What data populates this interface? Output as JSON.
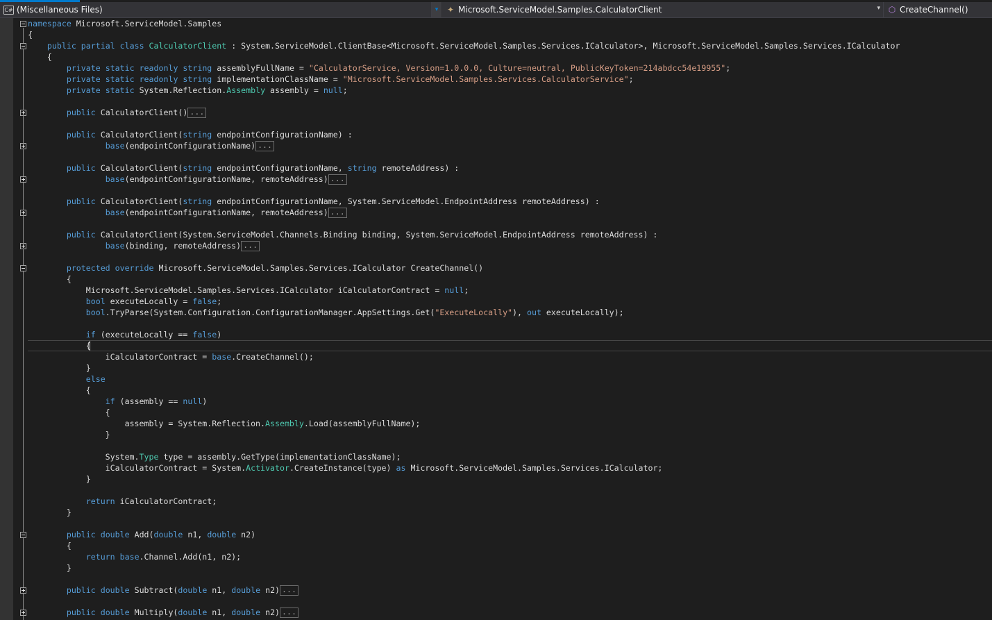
{
  "navbar": {
    "project": "(Miscellaneous Files)",
    "type": "Microsoft.ServiceModel.Samples.CalculatorClient",
    "member": "CreateChannel()"
  },
  "icons": {
    "project": "csharp-file-icon",
    "type": "class-icon",
    "member": "method-icon"
  },
  "colors": {
    "keyword": "#569cd6",
    "type": "#4ec9b0",
    "string": "#d69d85",
    "plain": "#dcdcdc",
    "background": "#1e1e1e"
  },
  "collapsed_marker": "...",
  "code": [
    [
      [
        "kw",
        "namespace"
      ],
      [
        "pl",
        " Microsoft.ServiceModel.Samples"
      ]
    ],
    [
      [
        "pl",
        "{"
      ]
    ],
    [
      [
        "pl",
        "    "
      ],
      [
        "kw",
        "public"
      ],
      [
        "pl",
        " "
      ],
      [
        "kw",
        "partial"
      ],
      [
        "pl",
        " "
      ],
      [
        "kw",
        "class"
      ],
      [
        "pl",
        " "
      ],
      [
        "ty",
        "CalculatorClient"
      ],
      [
        "pl",
        " : System.ServiceModel.ClientBase<Microsoft.ServiceModel.Samples.Services.ICalculator>, Microsoft.ServiceModel.Samples.Services.ICalculator"
      ]
    ],
    [
      [
        "pl",
        "    {"
      ]
    ],
    [
      [
        "pl",
        "        "
      ],
      [
        "kw",
        "private"
      ],
      [
        "pl",
        " "
      ],
      [
        "kw",
        "static"
      ],
      [
        "pl",
        " "
      ],
      [
        "kw",
        "readonly"
      ],
      [
        "pl",
        " "
      ],
      [
        "kw",
        "string"
      ],
      [
        "pl",
        " assemblyFullName = "
      ],
      [
        "str",
        "\"CalculatorService, Version=1.0.0.0, Culture=neutral, PublicKeyToken=214abdcc54e19955\""
      ],
      [
        "pl",
        ";"
      ]
    ],
    [
      [
        "pl",
        "        "
      ],
      [
        "kw",
        "private"
      ],
      [
        "pl",
        " "
      ],
      [
        "kw",
        "static"
      ],
      [
        "pl",
        " "
      ],
      [
        "kw",
        "readonly"
      ],
      [
        "pl",
        " "
      ],
      [
        "kw",
        "string"
      ],
      [
        "pl",
        " implementationClassName = "
      ],
      [
        "str",
        "\"Microsoft.ServiceModel.Samples.Services.CalculatorService\""
      ],
      [
        "pl",
        ";"
      ]
    ],
    [
      [
        "pl",
        "        "
      ],
      [
        "kw",
        "private"
      ],
      [
        "pl",
        " "
      ],
      [
        "kw",
        "static"
      ],
      [
        "pl",
        " System.Reflection."
      ],
      [
        "ty",
        "Assembly"
      ],
      [
        "pl",
        " assembly = "
      ],
      [
        "kw",
        "null"
      ],
      [
        "pl",
        ";"
      ]
    ],
    [],
    [
      [
        "pl",
        "        "
      ],
      [
        "kw",
        "public"
      ],
      [
        "pl",
        " CalculatorClient()"
      ],
      [
        "col",
        "..."
      ]
    ],
    [],
    [
      [
        "pl",
        "        "
      ],
      [
        "kw",
        "public"
      ],
      [
        "pl",
        " CalculatorClient("
      ],
      [
        "kw",
        "string"
      ],
      [
        "pl",
        " endpointConfigurationName) :"
      ]
    ],
    [
      [
        "pl",
        "                "
      ],
      [
        "kw",
        "base"
      ],
      [
        "pl",
        "(endpointConfigurationName)"
      ],
      [
        "col",
        "..."
      ]
    ],
    [],
    [
      [
        "pl",
        "        "
      ],
      [
        "kw",
        "public"
      ],
      [
        "pl",
        " CalculatorClient("
      ],
      [
        "kw",
        "string"
      ],
      [
        "pl",
        " endpointConfigurationName, "
      ],
      [
        "kw",
        "string"
      ],
      [
        "pl",
        " remoteAddress) :"
      ]
    ],
    [
      [
        "pl",
        "                "
      ],
      [
        "kw",
        "base"
      ],
      [
        "pl",
        "(endpointConfigurationName, remoteAddress)"
      ],
      [
        "col",
        "..."
      ]
    ],
    [],
    [
      [
        "pl",
        "        "
      ],
      [
        "kw",
        "public"
      ],
      [
        "pl",
        " CalculatorClient("
      ],
      [
        "kw",
        "string"
      ],
      [
        "pl",
        " endpointConfigurationName, System.ServiceModel.EndpointAddress remoteAddress) :"
      ]
    ],
    [
      [
        "pl",
        "                "
      ],
      [
        "kw",
        "base"
      ],
      [
        "pl",
        "(endpointConfigurationName, remoteAddress)"
      ],
      [
        "col",
        "..."
      ]
    ],
    [],
    [
      [
        "pl",
        "        "
      ],
      [
        "kw",
        "public"
      ],
      [
        "pl",
        " CalculatorClient(System.ServiceModel.Channels.Binding binding, System.ServiceModel.EndpointAddress remoteAddress) :"
      ]
    ],
    [
      [
        "pl",
        "                "
      ],
      [
        "kw",
        "base"
      ],
      [
        "pl",
        "(binding, remoteAddress)"
      ],
      [
        "col",
        "..."
      ]
    ],
    [],
    [
      [
        "pl",
        "        "
      ],
      [
        "kw",
        "protected"
      ],
      [
        "pl",
        " "
      ],
      [
        "kw",
        "override"
      ],
      [
        "pl",
        " Microsoft.ServiceModel.Samples.Services.ICalculator CreateChannel()"
      ]
    ],
    [
      [
        "pl",
        "        {"
      ]
    ],
    [
      [
        "pl",
        "            Microsoft.ServiceModel.Samples.Services.ICalculator iCalculatorContract = "
      ],
      [
        "kw",
        "null"
      ],
      [
        "pl",
        ";"
      ]
    ],
    [
      [
        "pl",
        "            "
      ],
      [
        "kw",
        "bool"
      ],
      [
        "pl",
        " executeLocally = "
      ],
      [
        "kw",
        "false"
      ],
      [
        "pl",
        ";"
      ]
    ],
    [
      [
        "pl",
        "            "
      ],
      [
        "kw",
        "bool"
      ],
      [
        "pl",
        ".TryParse(System.Configuration.ConfigurationManager.AppSettings.Get("
      ],
      [
        "str",
        "\"ExecuteLocally\""
      ],
      [
        "pl",
        "), "
      ],
      [
        "kw",
        "out"
      ],
      [
        "pl",
        " executeLocally);"
      ]
    ],
    [],
    [
      [
        "pl",
        "            "
      ],
      [
        "kw",
        "if"
      ],
      [
        "pl",
        " (executeLocally == "
      ],
      [
        "kw",
        "false"
      ],
      [
        "pl",
        ")"
      ]
    ],
    [
      [
        "pl",
        "            {"
      ]
    ],
    [
      [
        "pl",
        "                iCalculatorContract = "
      ],
      [
        "kw",
        "base"
      ],
      [
        "pl",
        ".CreateChannel();"
      ]
    ],
    [
      [
        "pl",
        "            }"
      ]
    ],
    [
      [
        "pl",
        "            "
      ],
      [
        "kw",
        "else"
      ]
    ],
    [
      [
        "pl",
        "            {"
      ]
    ],
    [
      [
        "pl",
        "                "
      ],
      [
        "kw",
        "if"
      ],
      [
        "pl",
        " (assembly == "
      ],
      [
        "kw",
        "null"
      ],
      [
        "pl",
        ")"
      ]
    ],
    [
      [
        "pl",
        "                {"
      ]
    ],
    [
      [
        "pl",
        "                    assembly = System.Reflection."
      ],
      [
        "ty",
        "Assembly"
      ],
      [
        "pl",
        ".Load(assemblyFullName);"
      ]
    ],
    [
      [
        "pl",
        "                }"
      ]
    ],
    [],
    [
      [
        "pl",
        "                System."
      ],
      [
        "ty",
        "Type"
      ],
      [
        "pl",
        " type = assembly.GetType(implementationClassName);"
      ]
    ],
    [
      [
        "pl",
        "                iCalculatorContract = System."
      ],
      [
        "ty",
        "Activator"
      ],
      [
        "pl",
        ".CreateInstance(type) "
      ],
      [
        "kw",
        "as"
      ],
      [
        "pl",
        " Microsoft.ServiceModel.Samples.Services.ICalculator;"
      ]
    ],
    [
      [
        "pl",
        "            }"
      ]
    ],
    [],
    [
      [
        "pl",
        "            "
      ],
      [
        "kw",
        "return"
      ],
      [
        "pl",
        " iCalculatorContract;"
      ]
    ],
    [
      [
        "pl",
        "        }"
      ]
    ],
    [],
    [
      [
        "pl",
        "        "
      ],
      [
        "kw",
        "public"
      ],
      [
        "pl",
        " "
      ],
      [
        "kw",
        "double"
      ],
      [
        "pl",
        " Add("
      ],
      [
        "kw",
        "double"
      ],
      [
        "pl",
        " n1, "
      ],
      [
        "kw",
        "double"
      ],
      [
        "pl",
        " n2)"
      ]
    ],
    [
      [
        "pl",
        "        {"
      ]
    ],
    [
      [
        "pl",
        "            "
      ],
      [
        "kw",
        "return"
      ],
      [
        "pl",
        " "
      ],
      [
        "kw",
        "base"
      ],
      [
        "pl",
        ".Channel.Add(n1, n2);"
      ]
    ],
    [
      [
        "pl",
        "        }"
      ]
    ],
    [],
    [
      [
        "pl",
        "        "
      ],
      [
        "kw",
        "public"
      ],
      [
        "pl",
        " "
      ],
      [
        "kw",
        "double"
      ],
      [
        "pl",
        " Subtract("
      ],
      [
        "kw",
        "double"
      ],
      [
        "pl",
        " n1, "
      ],
      [
        "kw",
        "double"
      ],
      [
        "pl",
        " n2)"
      ],
      [
        "col",
        "..."
      ]
    ],
    [],
    [
      [
        "pl",
        "        "
      ],
      [
        "kw",
        "public"
      ],
      [
        "pl",
        " "
      ],
      [
        "kw",
        "double"
      ],
      [
        "pl",
        " Multiply("
      ],
      [
        "kw",
        "double"
      ],
      [
        "pl",
        " n1, "
      ],
      [
        "kw",
        "double"
      ],
      [
        "pl",
        " n2)"
      ],
      [
        "col",
        "..."
      ]
    ]
  ]
}
